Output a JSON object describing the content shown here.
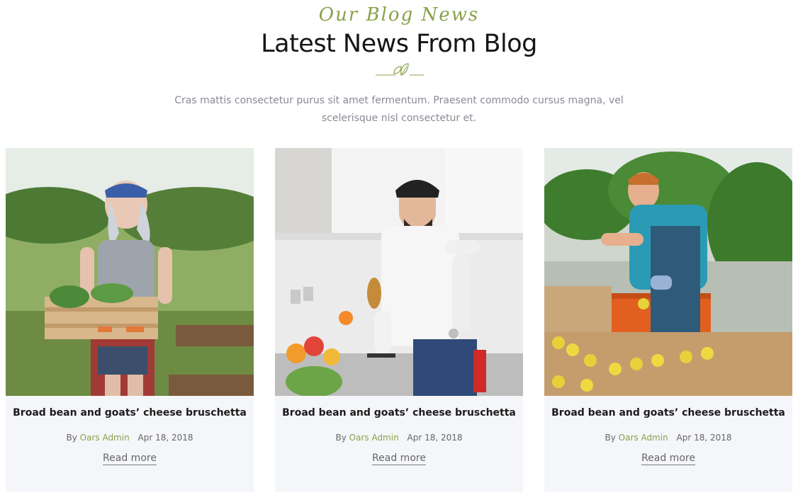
{
  "section": {
    "script_title": "Our Blog News",
    "title": "Latest News From Blog",
    "subtitle_line1": "Cras mattis consectetur purus sit amet fermentum. Praesent commodo cursus magna, vel",
    "subtitle_line2": "scelerisque nisl consectetur et."
  },
  "colors": {
    "accent": "#8aa04a",
    "card_bg": "#f5f6f9",
    "heading": "#151515",
    "muted": "#8a8a96"
  },
  "posts": [
    {
      "title": "Broad bean and goats’ cheese bruschetta",
      "by": "By",
      "author": "Oars Admin",
      "date": "Apr 18, 2018",
      "read_more": "Read more",
      "image": "woman-holding-vegetable-crate-photo"
    },
    {
      "title": "Broad bean and goats’ cheese bruschetta",
      "by": "By",
      "author": "Oars Admin",
      "date": "Apr 18, 2018",
      "read_more": "Read more",
      "image": "man-chopping-vegetables-kitchen-photo"
    },
    {
      "title": "Broad bean and goats’ cheese bruschetta",
      "by": "By",
      "author": "Oars Admin",
      "date": "Apr 18, 2018",
      "read_more": "Read more",
      "image": "greenhouse-worker-lemons-photo"
    }
  ]
}
